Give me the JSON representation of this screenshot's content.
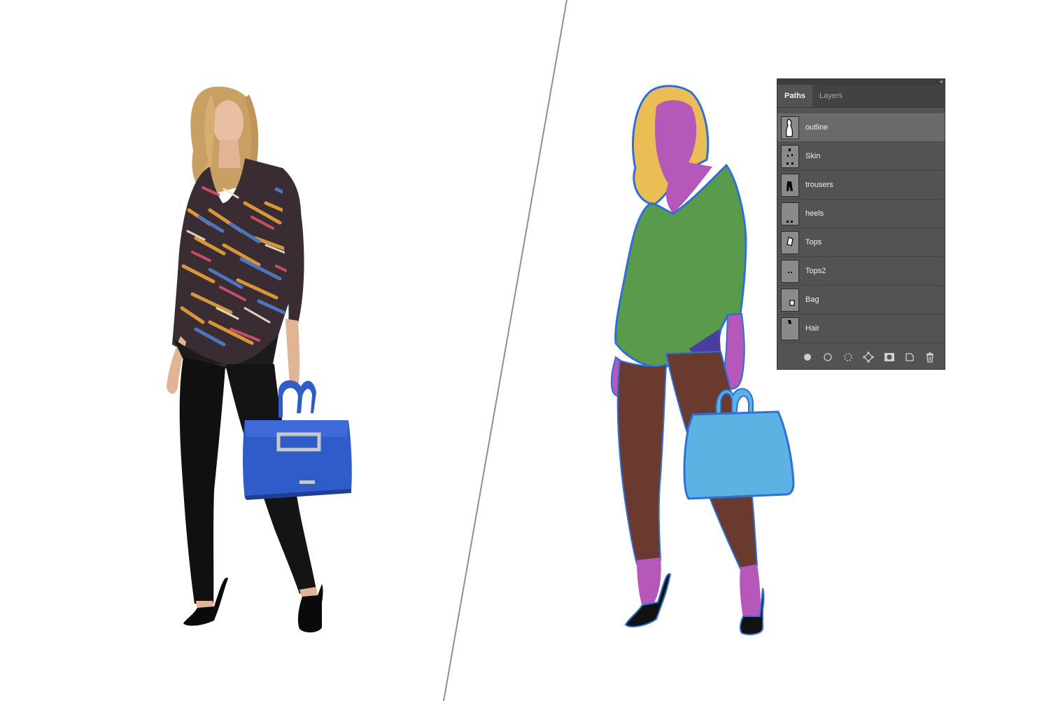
{
  "panel": {
    "tabs": [
      {
        "label": "Paths",
        "active": true
      },
      {
        "label": "Layers",
        "active": false
      }
    ],
    "paths": [
      {
        "label": "outline",
        "selected": true
      },
      {
        "label": "Skin",
        "selected": false
      },
      {
        "label": "trousers",
        "selected": false
      },
      {
        "label": "heels",
        "selected": false
      },
      {
        "label": "Tops",
        "selected": false
      },
      {
        "label": "Tops2",
        "selected": false
      },
      {
        "label": "Bag",
        "selected": false
      },
      {
        "label": "Hair",
        "selected": false
      }
    ],
    "footer_icons": [
      "fill-path-icon",
      "stroke-path-icon",
      "load-selection-icon",
      "make-work-path-icon",
      "add-mask-icon",
      "new-path-icon",
      "delete-path-icon"
    ]
  },
  "colors": {
    "hair": "#ebbe55",
    "skin": "#b558ba",
    "top": "#5a9b4b",
    "top2": "#4a3da2",
    "trousers": "#6a3a2e",
    "bag": "#5cb3e3",
    "heels": "#111111",
    "outline": "#2f6fd6",
    "photo_bag": "#2f5cc8"
  }
}
